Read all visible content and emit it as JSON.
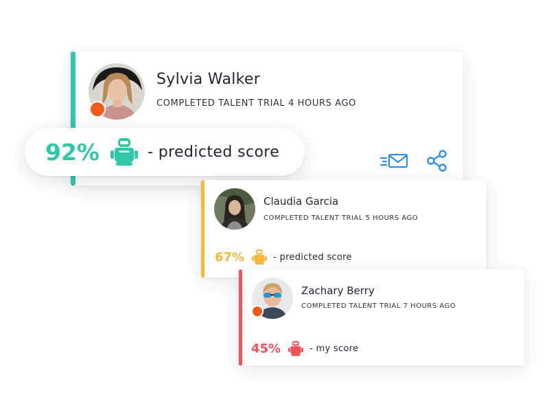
{
  "colors": {
    "teal": "#2fc8a8",
    "amber": "#f5b83d",
    "red": "#f0525a",
    "status_orange": "#f05a1a",
    "icon_blue": "#2a8fe6"
  },
  "cards": [
    {
      "name": "Sylvia Walker",
      "status": "COMPLETED TALENT TRIAL 4 HOURS AGO",
      "score_value": "92%",
      "score_label": "- predicted score",
      "accent": "#2fc8a8",
      "has_status_dot": true,
      "icons": [
        "robot-icon",
        "email-icon",
        "share-icon"
      ]
    },
    {
      "name": "Claudia Garcia",
      "status": "COMPLETED TALENT TRIAL 5 HOURS AGO",
      "score_value": "67%",
      "score_label": "- predicted score",
      "accent": "#f5b83d",
      "has_status_dot": false,
      "icons": [
        "robot-icon"
      ]
    },
    {
      "name": "Zachary Berry",
      "status": "COMPLETED TALENT TRIAL 7 HOURS AGO",
      "score_value": "45%",
      "score_label": "- my score",
      "accent": "#f0525a",
      "has_status_dot": true,
      "icons": [
        "robot-icon"
      ]
    }
  ]
}
